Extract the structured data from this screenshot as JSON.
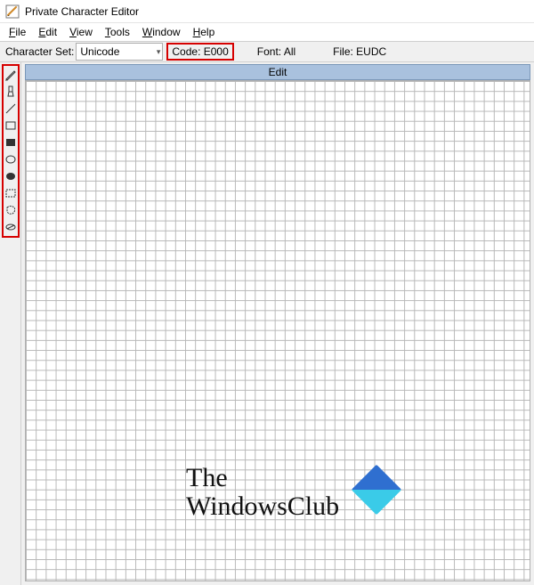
{
  "titlebar": {
    "title": "Private Character Editor"
  },
  "menubar": {
    "items": [
      {
        "label": "File",
        "accel_index": 0
      },
      {
        "label": "Edit",
        "accel_index": 0
      },
      {
        "label": "View",
        "accel_index": 0
      },
      {
        "label": "Tools",
        "accel_index": 0
      },
      {
        "label": "Window",
        "accel_index": 0
      },
      {
        "label": "Help",
        "accel_index": 0
      }
    ]
  },
  "infobar": {
    "charset_label": "Character Set:",
    "charset_value": "Unicode",
    "code_label": "Code:",
    "code_value": "E000",
    "font_label": "Font:",
    "font_value": "All",
    "file_label": "File:",
    "file_value": "EUDC"
  },
  "toolbox": {
    "tools": [
      "pencil",
      "brush",
      "line",
      "rectangle-outline",
      "rectangle-filled",
      "ellipse-outline",
      "ellipse-filled",
      "rect-select",
      "freeform-select",
      "eraser"
    ]
  },
  "canvas": {
    "title": "Edit"
  },
  "watermark": {
    "line1": "The",
    "line2": "WindowsClub"
  },
  "annotations": {
    "highlight_boxes": [
      "code-field",
      "toolbox"
    ],
    "highlight_color": "#d60000"
  }
}
